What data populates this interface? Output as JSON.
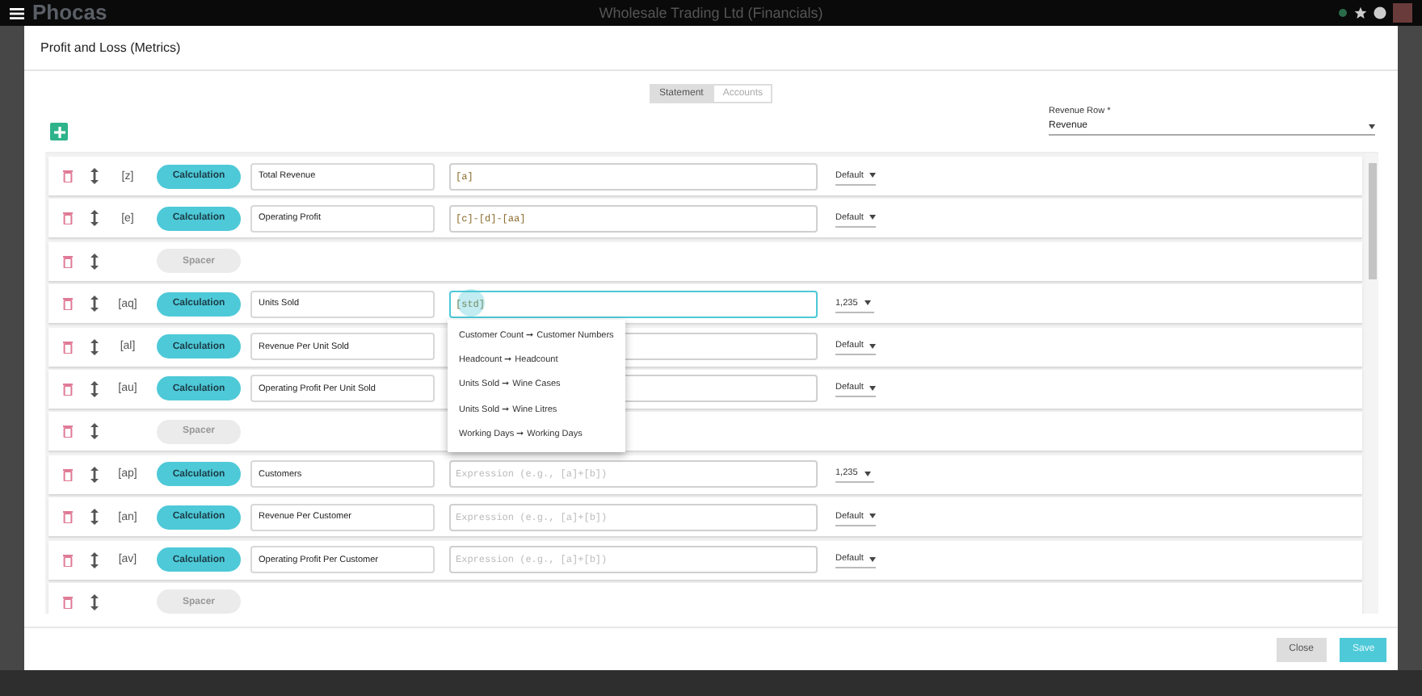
{
  "app_bar": {
    "logo": "Phocas",
    "title": "Wholesale Trading Ltd (Financials)"
  },
  "dialog": {
    "title": "Profit and Loss (Metrics)",
    "tabs": [
      {
        "label": "Statement",
        "selected": true
      },
      {
        "label": "Accounts",
        "selected": false
      }
    ],
    "revenue_row": {
      "label": "Revenue Row *",
      "value": "Revenue"
    },
    "rows": [
      {
        "kind": "calculation",
        "code": "[z]",
        "type": "Calculation",
        "name": "Total Revenue",
        "expression": "[a]",
        "focused": false,
        "format": "Default"
      },
      {
        "kind": "calculation",
        "code": "[e]",
        "type": "Calculation",
        "name": "Operating Profit",
        "expression": "[c]-[d]-[aa]",
        "focused": false,
        "format": "Default"
      },
      {
        "kind": "spacer",
        "type": "Spacer"
      },
      {
        "kind": "calculation",
        "code": "[aq]",
        "type": "Calculation",
        "name": "Units Sold",
        "expression": "[std]",
        "focused": true,
        "format": "1,235"
      },
      {
        "kind": "calculation",
        "code": "[al]",
        "type": "Calculation",
        "name": "Revenue Per Unit Sold",
        "expression": "",
        "focused": false,
        "format": "Default"
      },
      {
        "kind": "calculation",
        "code": "[au]",
        "type": "Calculation",
        "name": "Operating Profit Per Unit Sold",
        "expression": "",
        "focused": false,
        "format": "Default"
      },
      {
        "kind": "spacer",
        "type": "Spacer"
      },
      {
        "kind": "calculation",
        "code": "[ap]",
        "type": "Calculation",
        "name": "Customers",
        "placeholder": "Expression (e.g., [a]+[b])",
        "focused": false,
        "format": "1,235"
      },
      {
        "kind": "calculation",
        "code": "[an]",
        "type": "Calculation",
        "name": "Revenue Per Customer",
        "placeholder": "Expression (e.g., [a]+[b])",
        "focused": false,
        "format": "Default"
      },
      {
        "kind": "calculation",
        "code": "[av]",
        "type": "Calculation",
        "name": "Operating Profit Per Customer",
        "placeholder": "Expression (e.g., [a]+[b])",
        "focused": false,
        "format": "Default"
      },
      {
        "kind": "spacer",
        "type": "Spacer"
      }
    ],
    "suggestions": [
      "Customer Count ➞ Customer Numbers",
      "Headcount ➞ Headcount",
      "Units Sold ➞ Wine Cases",
      "Units Sold ➞ Wine Litres",
      "Working Days ➞ Working Days"
    ],
    "buttons": [
      {
        "label": "Close",
        "kind": "secondary"
      },
      {
        "label": "Save",
        "kind": "primary"
      }
    ]
  }
}
